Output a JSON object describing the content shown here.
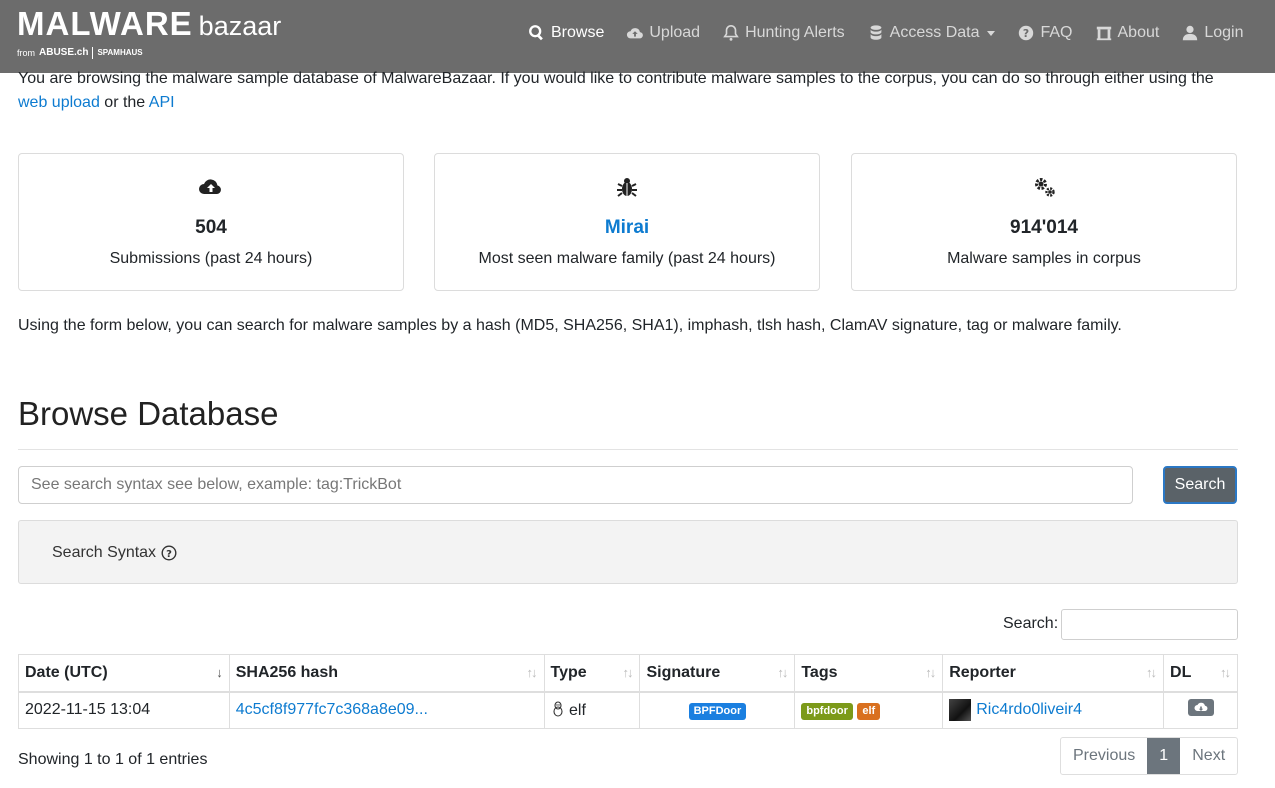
{
  "brand": {
    "main": "MALWARE",
    "sub": "bazaar",
    "from": "from",
    "abuse": "ABUSE.ch",
    "spamhaus": "SPAMHAUS"
  },
  "nav": {
    "browse": "Browse",
    "upload": "Upload",
    "hunting": "Hunting Alerts",
    "access": "Access Data",
    "faq": "FAQ",
    "about": "About",
    "login": "Login"
  },
  "intro": {
    "text1": "You are browsing the malware sample database of MalwareBazaar. If you would like to contribute malware samples to the corpus, you can do so through either using the",
    "link1": "web upload",
    "text2": " or the ",
    "link2": "API"
  },
  "stats": [
    {
      "icon": "cloud-upload-icon",
      "value": "504",
      "label": "Submissions (past 24 hours)"
    },
    {
      "icon": "bug-icon",
      "value": "Mirai",
      "label": "Most seen malware family (past 24 hours)"
    },
    {
      "icon": "cogs-icon",
      "value": "914'014",
      "label": "Malware samples in corpus"
    }
  ],
  "search_note": "Using the form below, you can search for malware samples by a hash (MD5, SHA256, SHA1), imphash, tlsh hash, ClamAV signature, tag or malware family.",
  "title": "Browse Database",
  "search": {
    "placeholder": "See search syntax see below, example: tag:TrickBot",
    "button": "Search",
    "syntax_label": "Search Syntax"
  },
  "table": {
    "search_label": "Search:",
    "columns": [
      "Date (UTC)",
      "SHA256 hash",
      "Type",
      "Signature",
      "Tags",
      "Reporter",
      "DL"
    ],
    "rows": [
      {
        "date": "2022-11-15 13:04",
        "hash": "4c5cf8f977fc7c368a8e09...",
        "type": "elf",
        "signature": "BPFDoor",
        "tags": [
          "bpfdoor",
          "elf"
        ],
        "reporter": "Ric4rdo0liveir4"
      }
    ]
  },
  "footer": {
    "showing": "Showing 1 to 1 of 1 entries",
    "previous": "Previous",
    "page": "1",
    "next": "Next"
  },
  "colors": {
    "navbar": "#6c6c6c",
    "link": "#0d7bd0",
    "badge_signature": "#1a7fe0",
    "badge_tag1": "#7c9a19",
    "badge_tag2": "#d9701f"
  }
}
